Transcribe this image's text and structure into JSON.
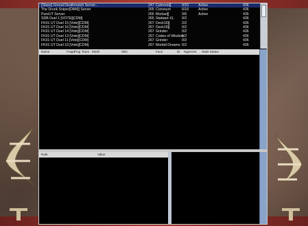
{
  "servers": [
    {
      "name": "[Steps] Unreal Deathmatch Server...",
      "ping": "247",
      "map": "Cybreon][",
      "players": "0/10",
      "status": "Active",
      "max": "436",
      "selected": true
    },
    {
      "name": "The Drunk Sniper[DM4]] Server",
      "ping": "265",
      "map": "Conveyor",
      "players": "6/16",
      "status": "Active",
      "max": "436",
      "selected": false
    },
    {
      "name": "PureUT Server",
      "ping": "265",
      "map": "Morlasi][",
      "players": "0/6",
      "status": "Active",
      "max": "436",
      "selected": false
    },
    {
      "name": "SDB Duel 1 [VOTE][CDM]",
      "ping": "265",
      "map": "Stalwart XL",
      "players": "0/2",
      "status": "",
      "max": "436",
      "selected": false
    },
    {
      "name": "FK01 UT Duel 15 [Vote][CDM]",
      "ping": "267",
      "map": "Deck16][",
      "players": "2/2",
      "status": "",
      "max": "436",
      "selected": false
    },
    {
      "name": "FK01 UT Duel 16 [Vote][CDM]",
      "ping": "267",
      "map": "Deck16][",
      "players": "0/2",
      "status": "",
      "max": "436",
      "selected": false
    },
    {
      "name": "FK01 UT Duel 14 [Vote][CDM]",
      "ping": "267",
      "map": "Grinder",
      "players": "0/2",
      "status": "",
      "max": "436",
      "selected": false
    },
    {
      "name": "FK01 UT Duel 13 [Vote][CDM]",
      "ping": "267",
      "map": "Codex of Wisdom",
      "players": "1/2",
      "status": "",
      "max": "436",
      "selected": false
    },
    {
      "name": "FK01 UT Duel 11 [Vote][CDM]",
      "ping": "267",
      "map": "Grinder",
      "players": "0/2",
      "status": "",
      "max": "436",
      "selected": false
    },
    {
      "name": "FK01 UT Duel 10 [Vote][CDM]",
      "ping": "267",
      "map": "Morbid Dreams",
      "players": "0/2",
      "status": "",
      "max": "436",
      "selected": false
    }
  ],
  "player_columns": [
    "Name",
    "Frags",
    "Ping",
    "Team",
    "Mesh",
    "Skin",
    "Face",
    "ID",
    "Ngsecret",
    "Stats Status"
  ],
  "rules_columns": [
    "Rule",
    "Value"
  ],
  "colors": {
    "selection": "#1a2a6a",
    "scroll_blue": "#8aa3c8",
    "header_grey": "#d9d9d9"
  }
}
